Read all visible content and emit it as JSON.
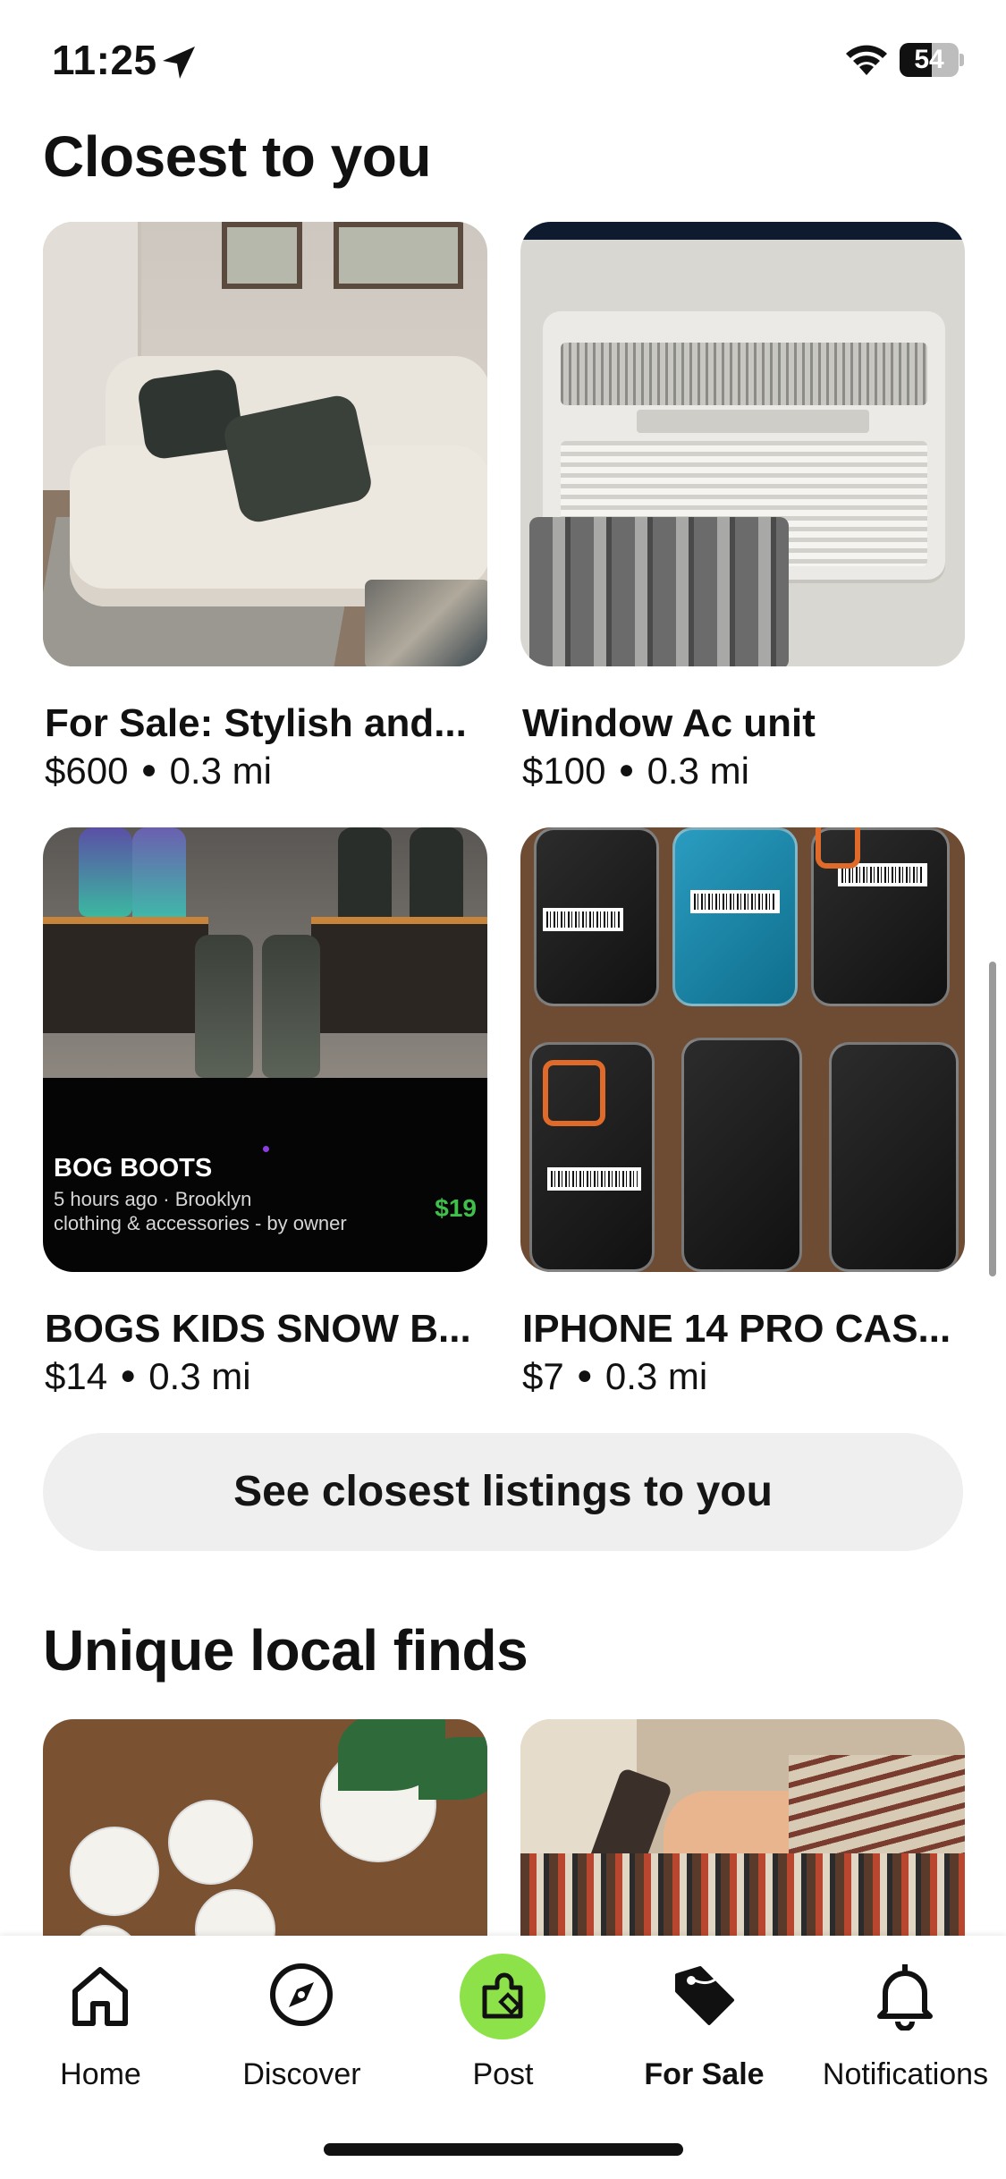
{
  "status_bar": {
    "time": "11:25",
    "battery": "54"
  },
  "sections": {
    "closest": {
      "title": "Closest to you"
    },
    "unique": {
      "title": "Unique local finds"
    }
  },
  "listings": [
    {
      "title": "For Sale: Stylish and...",
      "price": "$600",
      "distance": "0.3 mi"
    },
    {
      "title": "Window Ac unit",
      "price": "$100",
      "distance": "0.3 mi"
    },
    {
      "title": "BOGS KIDS SNOW B...",
      "price": "$14",
      "distance": "0.3 mi",
      "overlay": {
        "name": "BOG BOOTS",
        "line1": "5 hours ago · Brooklyn",
        "line2": "clothing & accessories - by owner",
        "price": "$19"
      }
    },
    {
      "title": "IPHONE 14 PRO CAS...",
      "price": "$7",
      "distance": "0.3 mi"
    }
  ],
  "see_closest_button": "See closest listings to you",
  "tab_bar": {
    "items": [
      {
        "label": "Home",
        "icon": "home-icon"
      },
      {
        "label": "Discover",
        "icon": "compass-icon"
      },
      {
        "label": "Post",
        "icon": "post-tag-icon"
      },
      {
        "label": "For Sale",
        "icon": "price-tag-icon",
        "active": true
      },
      {
        "label": "Notifications",
        "icon": "bell-icon"
      }
    ]
  },
  "colors": {
    "post_accent": "#8de24a",
    "price_green": "#3ec04a"
  }
}
